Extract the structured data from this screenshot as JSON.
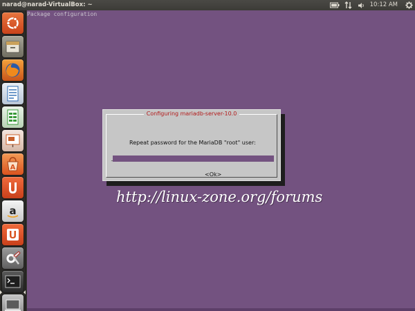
{
  "top_panel": {
    "window_title": "narad@narad-VirtualBox: ~",
    "clock": "10:12 AM",
    "icons": [
      "battery-icon",
      "network-icon",
      "volume-icon",
      "settings-icon"
    ]
  },
  "launcher": {
    "items": [
      {
        "name": "ubuntu-dash-icon",
        "color": "#e05a2b"
      },
      {
        "name": "file-manager-icon",
        "color": "#8a8a7a"
      },
      {
        "name": "firefox-icon",
        "color": "#e87c1e"
      },
      {
        "name": "writer-icon",
        "color": "#2e6db4"
      },
      {
        "name": "calc-icon",
        "color": "#3a9a3a"
      },
      {
        "name": "impress-icon",
        "color": "#c8602a"
      },
      {
        "name": "software-center-icon",
        "color": "#e86a2a"
      },
      {
        "name": "ubuntu-one-icon",
        "color": "#e04e1b"
      },
      {
        "name": "amazon-icon",
        "color": "#d8d8d8"
      },
      {
        "name": "ubuntu-one-music-icon",
        "color": "#e04e1b"
      },
      {
        "name": "system-settings-icon",
        "color": "#8a8a8a"
      },
      {
        "name": "terminal-icon",
        "color": "#3c3c3c"
      },
      {
        "name": "workspace-icon",
        "color": "#9a9a9a"
      }
    ]
  },
  "terminal": {
    "header_text": "Package configuration",
    "background": "#735280"
  },
  "dialog": {
    "title": "Configuring mariadb-server-10.0",
    "prompt": "Repeat password for the MariaDB \"root\" user:",
    "cursor": "_",
    "ok_label": "<Ok>",
    "title_color": "#b31a1a"
  },
  "watermark": {
    "text": "http://linux-zone.org/forums"
  }
}
